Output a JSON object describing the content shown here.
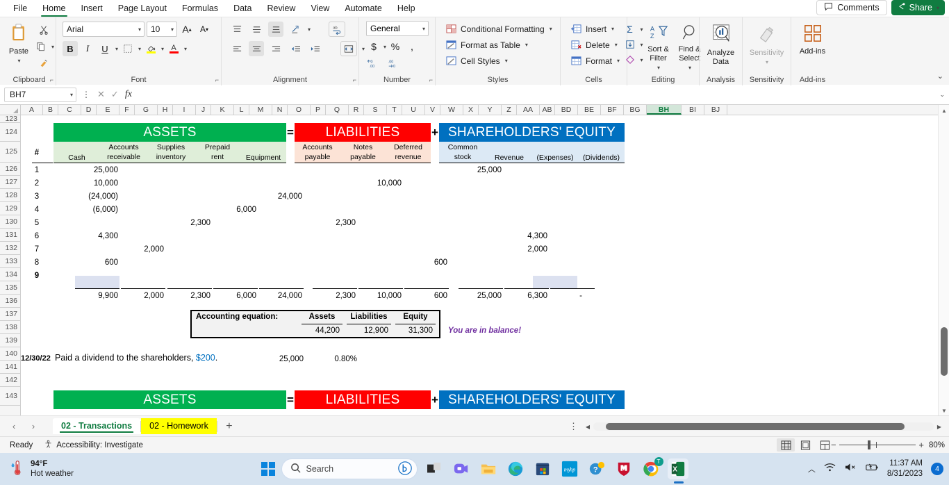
{
  "ribbon": {
    "tabs": [
      {
        "label": "File"
      },
      {
        "label": "Home"
      },
      {
        "label": "Insert"
      },
      {
        "label": "Page Layout"
      },
      {
        "label": "Formulas"
      },
      {
        "label": "Data"
      },
      {
        "label": "Review"
      },
      {
        "label": "View"
      },
      {
        "label": "Automate"
      },
      {
        "label": "Help"
      }
    ],
    "comments_label": "Comments",
    "share_label": "Share",
    "groups": {
      "clipboard": {
        "label": "Clipboard",
        "paste": "Paste"
      },
      "font": {
        "label": "Font",
        "font_name": "Arial",
        "font_size": "10"
      },
      "alignment": {
        "label": "Alignment"
      },
      "number": {
        "label": "Number",
        "format": "General"
      },
      "styles": {
        "label": "Styles",
        "conditional_formatting": "Conditional Formatting",
        "format_as_table": "Format as Table",
        "cell_styles": "Cell Styles"
      },
      "cells": {
        "label": "Cells",
        "insert": "Insert",
        "delete": "Delete",
        "format": "Format"
      },
      "editing": {
        "label": "Editing",
        "sort_filter": "Sort & Filter",
        "find_select": "Find & Select"
      },
      "analysis": {
        "label": "Analysis",
        "analyze_data": "Analyze Data"
      },
      "sensitivity": {
        "label": "Sensitivity",
        "sensitivity": "Sensitivity"
      },
      "addins": {
        "label": "Add-ins",
        "addins": "Add-ins"
      }
    }
  },
  "formula_bar": {
    "name_box": "BH7",
    "formula": ""
  },
  "grid": {
    "column_headers": [
      "A",
      "B",
      "C",
      "D",
      "E",
      "F",
      "G",
      "H",
      "I",
      "J",
      "K",
      "L",
      "M",
      "N",
      "O",
      "P",
      "Q",
      "R",
      "S",
      "T",
      "U",
      "V",
      "W",
      "X",
      "Y",
      "Z",
      "AA",
      "AB",
      "BD",
      "BE",
      "BF",
      "BG",
      "BH",
      "BI",
      "BJ"
    ],
    "selected_column": "BH",
    "row_headers": [
      "123",
      "124",
      "125",
      "126",
      "127",
      "128",
      "129",
      "130",
      "131",
      "132",
      "133",
      "134",
      "135",
      "136",
      "137",
      "138",
      "139",
      "140",
      "141",
      "142",
      "143"
    ]
  },
  "worksheet": {
    "sections": [
      {
        "banner": "ASSETS",
        "color": "#00b050",
        "columns": [
          "Cash",
          "Accounts receivable",
          "Supplies inventory",
          "Prepaid rent",
          "Equipment"
        ],
        "column_lines": [
          [
            "",
            "Cash"
          ],
          [
            "Accounts",
            "receivable"
          ],
          [
            "Supplies",
            "inventory"
          ],
          [
            "Prepaid",
            "rent"
          ],
          [
            "",
            "Equipment"
          ]
        ],
        "totals": [
          "9,900",
          "2,000",
          "2,300",
          "6,000",
          "24,000"
        ]
      },
      {
        "banner": "LIABILITIES",
        "color": "#ff0000",
        "operator": "=",
        "columns": [
          "Accounts payable",
          "Notes payable",
          "Deferred revenue"
        ],
        "column_lines": [
          [
            "Accounts",
            "payable"
          ],
          [
            "Notes",
            "payable"
          ],
          [
            "Deferred",
            "revenue"
          ]
        ],
        "totals": [
          "2,300",
          "10,000",
          "600"
        ]
      },
      {
        "banner": "SHAREHOLDERS' EQUITY",
        "color": "#0070c0",
        "operator": "+",
        "columns": [
          "Common stock",
          "Revenue",
          "(Expenses)",
          "(Dividends)"
        ],
        "column_lines": [
          [
            "Common",
            "stock"
          ],
          [
            "",
            "Revenue"
          ],
          [
            "",
            "(Expenses)"
          ],
          [
            "",
            "(Dividends)"
          ]
        ],
        "totals": [
          "25,000",
          "6,300",
          "-",
          ""
        ]
      }
    ],
    "row_number_header": "#",
    "rows": [
      {
        "num": "1",
        "cash": "25,000",
        "ar": "",
        "supplies": "",
        "prepaid": "",
        "equipment": "",
        "ap": "",
        "np": "",
        "dr": "",
        "cs": "25,000",
        "rev": "",
        "exp": "",
        "div": ""
      },
      {
        "num": "2",
        "cash": "10,000",
        "ar": "",
        "supplies": "",
        "prepaid": "",
        "equipment": "",
        "ap": "",
        "np": "10,000",
        "dr": "",
        "cs": "",
        "rev": "",
        "exp": "",
        "div": ""
      },
      {
        "num": "3",
        "cash": "(24,000)",
        "ar": "",
        "supplies": "",
        "prepaid": "",
        "equipment": "24,000",
        "ap": "",
        "np": "",
        "dr": "",
        "cs": "",
        "rev": "",
        "exp": "",
        "div": ""
      },
      {
        "num": "4",
        "cash": "(6,000)",
        "ar": "",
        "supplies": "",
        "prepaid": "6,000",
        "equipment": "",
        "ap": "",
        "np": "",
        "dr": "",
        "cs": "",
        "rev": "",
        "exp": "",
        "div": ""
      },
      {
        "num": "5",
        "cash": "",
        "ar": "",
        "supplies": "2,300",
        "prepaid": "",
        "equipment": "",
        "ap": "2,300",
        "np": "",
        "dr": "",
        "cs": "",
        "rev": "",
        "exp": "",
        "div": ""
      },
      {
        "num": "6",
        "cash": "4,300",
        "ar": "",
        "supplies": "",
        "prepaid": "",
        "equipment": "",
        "ap": "",
        "np": "",
        "dr": "",
        "cs": "",
        "rev": "4,300",
        "exp": "",
        "div": ""
      },
      {
        "num": "7",
        "cash": "",
        "ar": "2,000",
        "supplies": "",
        "prepaid": "",
        "equipment": "",
        "ap": "",
        "np": "",
        "dr": "",
        "cs": "",
        "rev": "2,000",
        "exp": "",
        "div": ""
      },
      {
        "num": "8",
        "cash": "600",
        "ar": "",
        "supplies": "",
        "prepaid": "",
        "equipment": "",
        "ap": "",
        "np": "",
        "dr": "600",
        "cs": "",
        "rev": "",
        "exp": "",
        "div": ""
      },
      {
        "num": "9",
        "cash": "",
        "ar": "",
        "supplies": "",
        "prepaid": "",
        "equipment": "",
        "ap": "",
        "np": "",
        "dr": "",
        "cs": "",
        "rev": "",
        "exp": "",
        "div": ""
      }
    ],
    "equation_box": {
      "label": "Accounting equation:",
      "headers": [
        "Assets",
        "Liabilities",
        "Equity"
      ],
      "values": [
        "44,200",
        "12,900",
        "31,300"
      ]
    },
    "balance_note": "You are in balance!",
    "transaction": {
      "date": "12/30/22",
      "text_before": "Paid a dividend to the shareholders, ",
      "amount": "$200",
      "text_after": ".",
      "value": "25,000",
      "percent": "0.80%"
    },
    "bottom_sections": [
      {
        "banner": "ASSETS",
        "color": "#00b050"
      },
      {
        "banner": "LIABILITIES",
        "color": "#ff0000",
        "operator": "="
      },
      {
        "banner": "SHAREHOLDERS' EQUITY",
        "color": "#0070c0",
        "operator": "+"
      }
    ]
  },
  "sheet_tabs": {
    "tabs": [
      {
        "label": "02 - Transactions",
        "state": "active"
      },
      {
        "label": "02 - Homework",
        "state": "highlighted"
      }
    ],
    "add_label": "+"
  },
  "status_bar": {
    "state": "Ready",
    "accessibility": "Accessibility: Investigate",
    "zoom": "80%"
  },
  "taskbar": {
    "weather_temp": "94°F",
    "weather_desc": "Hot weather",
    "search_placeholder": "Search",
    "time": "11:37 AM",
    "date": "8/31/2023",
    "notification_count": "4",
    "chrome_badge": "T",
    "apps": [
      "widgets-icon",
      "copilot-icon",
      "teams-icon",
      "file-explorer-icon",
      "edge-icon",
      "store-icon",
      "myhp-icon",
      "help-icon",
      "mcafee-icon",
      "chrome-icon",
      "excel-icon"
    ]
  }
}
